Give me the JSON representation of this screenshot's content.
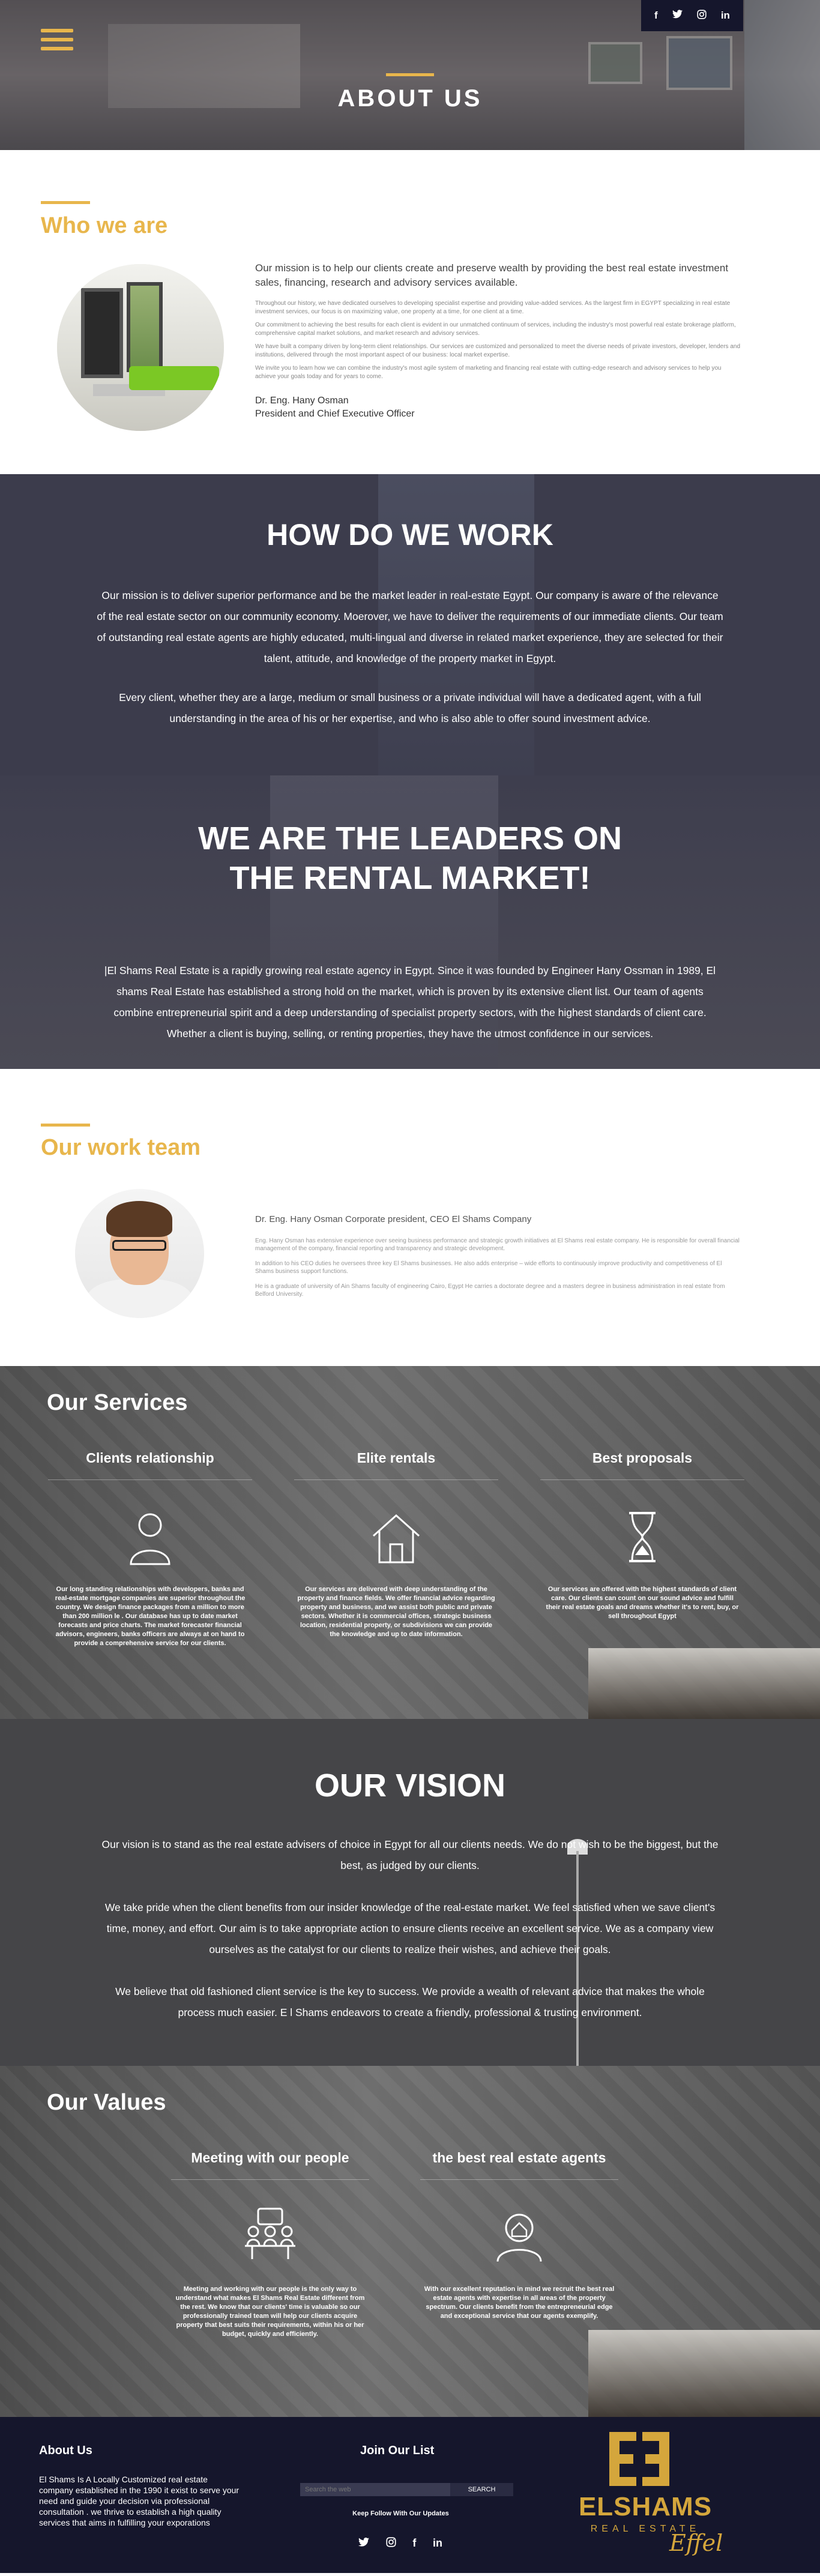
{
  "hero": {
    "title": "ABOUT US"
  },
  "social_top": [
    "f",
    "t",
    "ig",
    "in"
  ],
  "who": {
    "heading": "Who we are",
    "lead": "Our mission is to help our clients create and preserve wealth by providing the best real estate investment sales, financing, research and advisory services available.",
    "p1": "Throughout our history, we have dedicated ourselves to developing specialist expertise and providing value-added services. As the largest firm in EGYPT specializing in real estate investment services, our focus is on maximizing value, one property at a time, for one client at a time.",
    "p2": "Our commitment to achieving the best results for each client is evident in our unmatched continuum of services, including the industry's most powerful real estate brokerage platform, comprehensive capital market solutions, and market research and advisory services.",
    "p3": "We have built a company driven by long-term client relationships. Our services are customized and personalized to meet the diverse needs of private investors, developer, lenders and institutions, delivered through the most important aspect of our business: local market expertise.",
    "p4": "We invite you to learn how we can combine the industry's most agile system of marketing and financing real estate with cutting-edge research and advisory services to help you achieve your goals today and for years to come.",
    "sig_name": "Dr. Eng. Hany Osman",
    "sig_title": "President and Chief Executive Officer"
  },
  "howdo": {
    "heading": "HOW DO WE WORK",
    "p1": "Our mission is to deliver superior performance and be the market leader in real-estate Egypt. Our company is aware of the relevance of the real estate sector on our community economy. Moerover, we have to deliver the requirements of our immediate clients. Our team of outstanding real estate agents are highly educated, multi-lingual and diverse in related market experience, they are selected for their talent, attitude, and knowledge of the property market in Egypt.",
    "p2": "Every client, whether they are a large, medium or small business or a private individual will have a dedicated agent, with a full understanding in the area of his or her expertise, and who is also able to offer sound investment advice."
  },
  "leaders": {
    "heading1": "WE ARE THE LEADERS ON",
    "heading2": "THE RENTAL MARKET!",
    "p": "|El Shams Real Estate is a rapidly growing real estate agency in Egypt. Since it was founded by Engineer Hany Ossman in 1989, El shams Real Estate has established a strong hold on the market, which is proven by its extensive client list. Our team of agents combine entrepreneurial spirit and a deep understanding of specialist property sectors, with the highest standards of client care. Whether a client is buying, selling, or renting properties, they have the utmost confidence in our services."
  },
  "team": {
    "heading": "Our work team",
    "lead": "Dr. Eng. Hany Osman Corporate president, CEO El Shams Company",
    "p1": "Eng. Hany Osman has extensive experience over seeing business performance and strategic growth initiatives at El Shams real estate company. He is responsible for overall financial management of the company, financial reporting and transparency and strategic development.",
    "p2": "In addition to his CEO duties he oversees three key El Shams businesses. He also adds enterprise – wide efforts to continuously improve productivity and competitiveness of El Shams business support functions.",
    "p3": "He is a graduate of university of Ain Shams faculty of engineering Cairo, Egypt He carries a doctorate degree and a masters degree in business administration in real estate from Belford University."
  },
  "services": {
    "heading": "Our Services",
    "items": [
      {
        "title": "Clients relationship",
        "icon": "person-icon",
        "text": "Our long standing relationships with developers, banks and real-estate mortgage companies are superior throughout the country. We design finance packages from a million to more than 200 million le . Our database has up to date market forecasts and price charts. The market forecaster financial advisors, engineers, banks officers are always at on hand to provide a comprehensive service for our clients."
      },
      {
        "title": "Elite rentals",
        "icon": "house-icon",
        "text": "Our services are delivered with deep understanding of the property and finance fields. We offer financial advice regarding property and business, and we assist both public and private sectors. Whether it is commercial offices, strategic business location, residential property, or subdivisions we can provide the knowledge and up to date information."
      },
      {
        "title": "Best proposals",
        "icon": "hourglass-icon",
        "text": "Our services are offered with the highest standards of client care. Our clients can count on our sound advice and fulfill their real estate goals and dreams whether it's to rent, buy, or sell throughout Egypt"
      }
    ]
  },
  "vision": {
    "heading": "OUR VISION",
    "p1": "Our vision is to stand as the real estate advisers of choice in Egypt for all our clients needs. We do not wish to be the biggest, but the best, as judged by our clients.",
    "p2": "We take pride when the client benefits from our insider knowledge of the real-estate market. We feel satisfied when we save client's time, money, and effort. Our aim is to take appropriate action to ensure clients receive an excellent service. We as a company view ourselves as the catalyst for our clients to realize their wishes, and achieve their goals.",
    "p3": "We believe that old fashioned client service is the key to success. We provide a wealth of relevant advice that makes the whole process much easier. E l Shams endeavors to create a friendly, professional & trusting environment."
  },
  "values": {
    "heading": "Our Values",
    "items": [
      {
        "title": "Meeting with our people",
        "icon": "meeting-icon",
        "text": "Meeting and working with our people is the only way to understand what makes El Shams Real Estate different from the rest. We know that our clients' time is valuable so our professionally trained team will help our clients acquire property that best suits their requirements, within his or her budget, quickly and efficiently."
      },
      {
        "title": "the best real estate agents",
        "icon": "agent-icon",
        "text": "With our excellent reputation in mind we recruit the best real estate agents with expertise in all areas of the property spectrum. Our clients benefit from the entrepreneurial edge and exceptional service that our agents exemplify."
      }
    ]
  },
  "footer": {
    "about_heading": "About Us",
    "about_text": "El Shams Is A Locally Customized real estate company established in the 1990 it exist to serve your need and guide your decision via professional consultation . we thrive to establish a high quality services that aims in fulfilling your exporations",
    "join_heading": "Join Our List",
    "email_placeholder": "Search the web",
    "search_label": "SEARCH",
    "keep_follow": "Keep Follow With Our Updates",
    "social": [
      "t",
      "ig",
      "f",
      "in"
    ],
    "logo_name": "ELSHAMS",
    "logo_sub": "REAL ESTATE",
    "logo_script": "Effel",
    "gold": "#e8b64c",
    "navy": "#15162c"
  }
}
